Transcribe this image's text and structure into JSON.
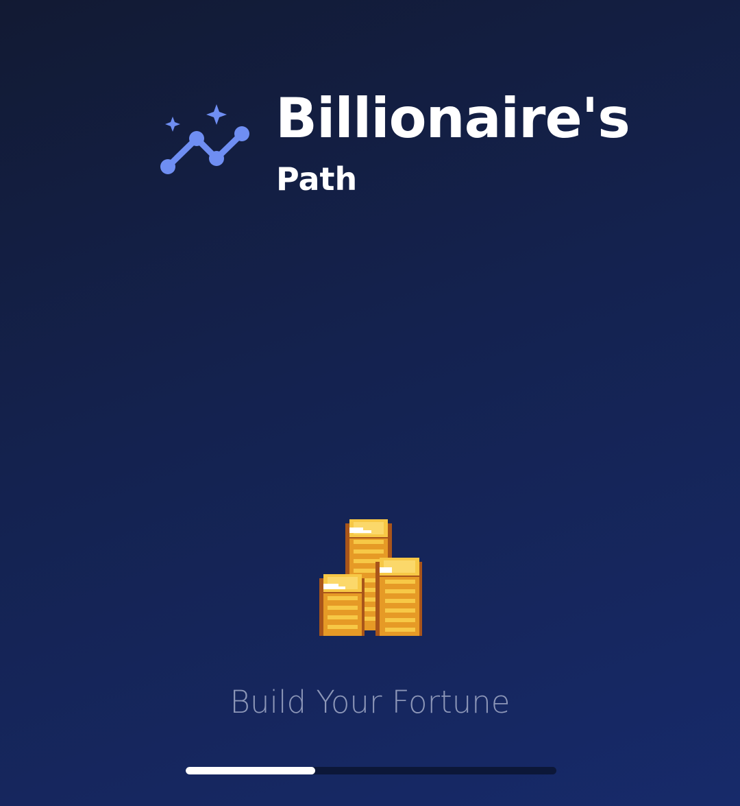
{
  "app": {
    "title": "Billionaire's",
    "subtitle": "Path",
    "tagline": "Build Your Fortune",
    "logo_icon": "trending-chart-sparkles-icon",
    "hero_icon": "gold-coin-stacks-icon"
  },
  "loading": {
    "progress": 0.35
  },
  "colors": {
    "accent": "#6f8ef2",
    "background_top": "#121a33",
    "background_bottom": "#172a6a",
    "text_primary": "#ffffff",
    "text_secondary": "#8d97b8",
    "progress_fill": "#ffffff",
    "progress_track": "#0c1738",
    "coin_gold": "#f2b833",
    "coin_dark": "#a9551a"
  }
}
